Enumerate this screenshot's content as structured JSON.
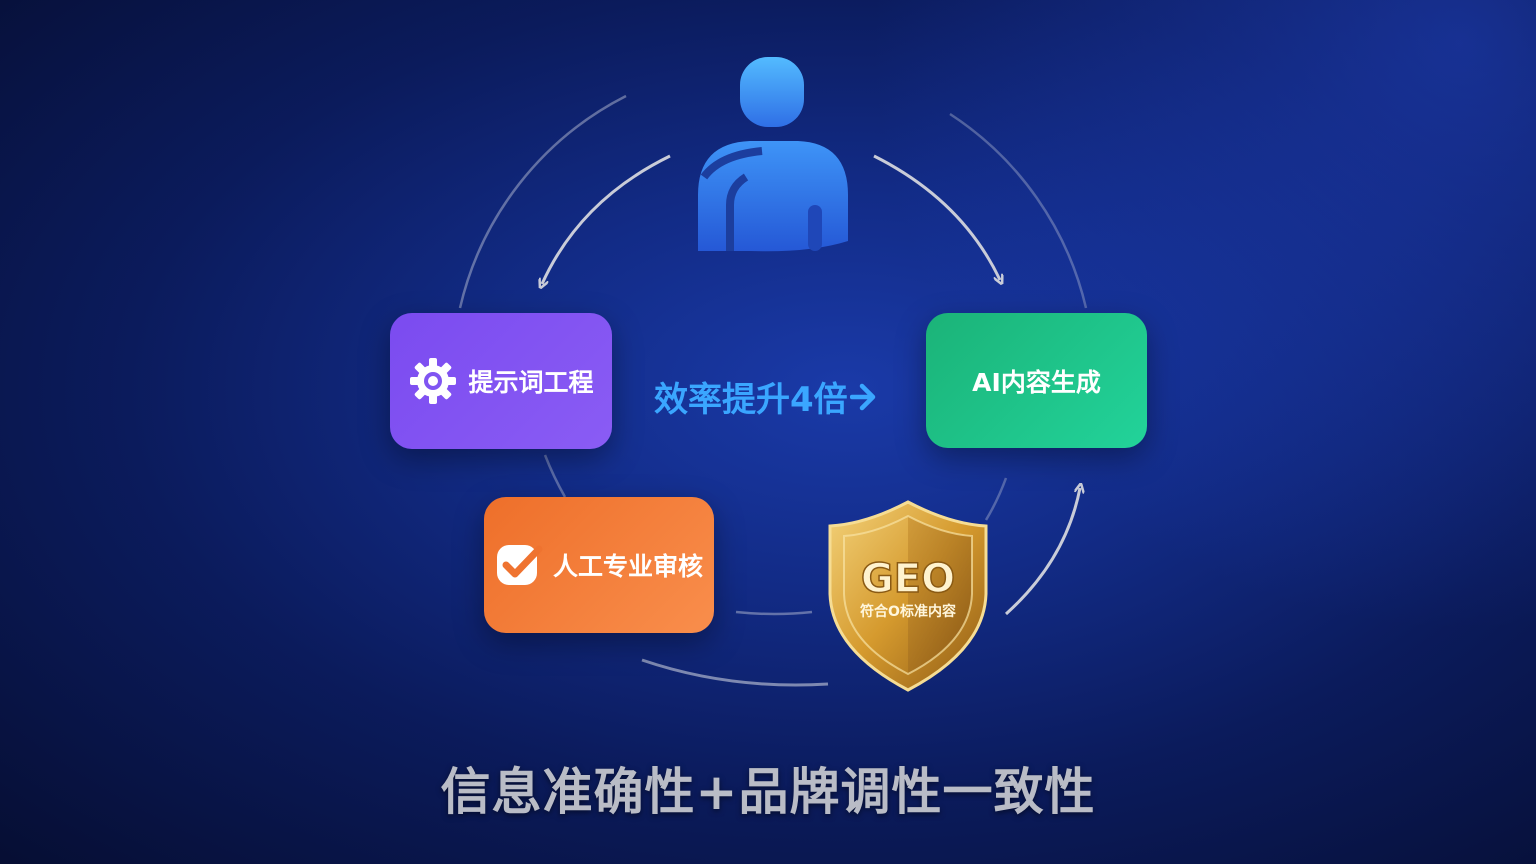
{
  "person": {
    "icon": "person-icon"
  },
  "cards": {
    "prompt": {
      "label": "提示词工程",
      "icon": "gear-icon",
      "color": "#7b4bf0"
    },
    "ai": {
      "label": "AI内容生成",
      "color": "#1fc487"
    },
    "review": {
      "label": "人工专业审核",
      "icon": "check-icon",
      "color": "#f27a36"
    }
  },
  "center": {
    "label": "效率提升4倍",
    "color": "#3aa6ff"
  },
  "shield": {
    "title": "GEO",
    "subtitle": "符合O标准内容",
    "icon": "shield-icon",
    "color": "#d8a23a"
  },
  "footer": {
    "title": "信息准确性+品牌调性一致性"
  }
}
